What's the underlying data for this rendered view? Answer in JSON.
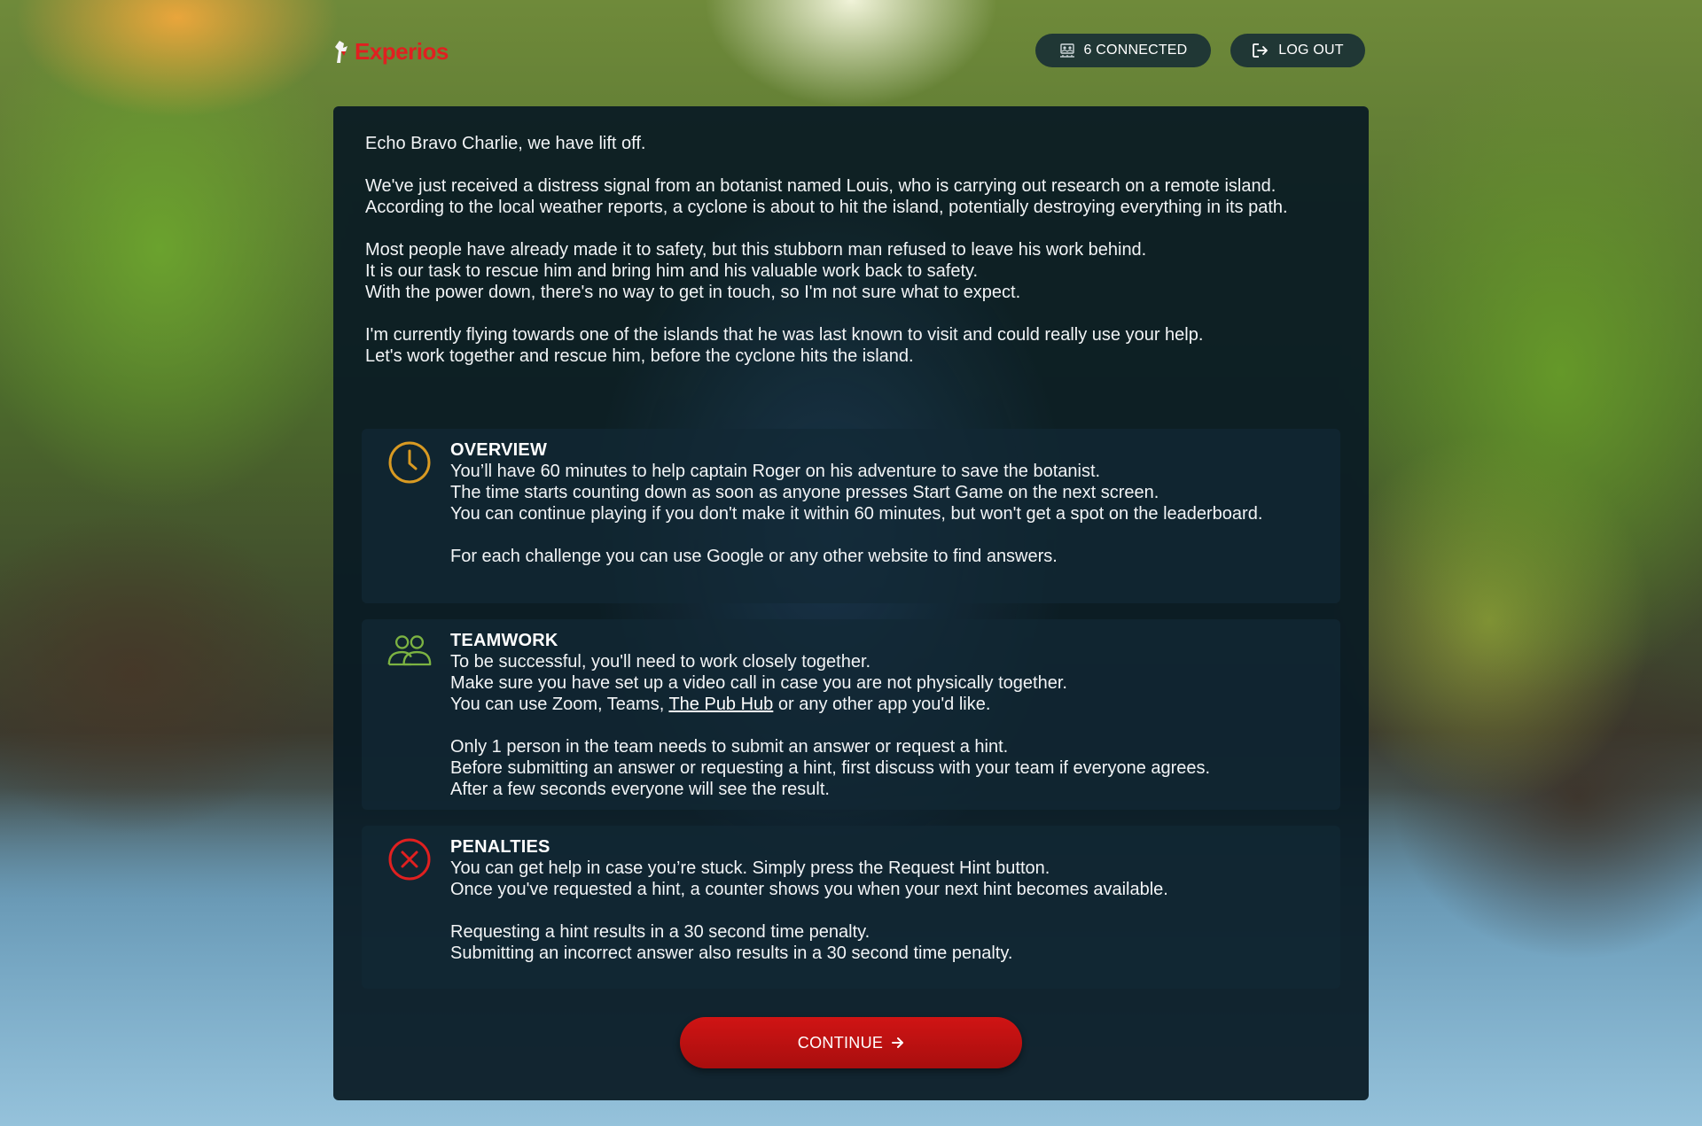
{
  "brand": {
    "name": "Experios",
    "logo_color": "#e02020"
  },
  "header": {
    "connected_label": "6 CONNECTED",
    "connected_icon": "users-icon",
    "logout_label": "LOG OUT",
    "logout_icon": "logout-icon"
  },
  "intro": {
    "greeting": "Echo Bravo Charlie, we have lift off.",
    "paragraph1": "We've just received a distress signal from an botanist named Louis, who is carrying out research on a remote island. According to the local weather reports, a cyclone is about to hit the island, potentially destroying everything in its path.",
    "paragraph2": [
      "Most people have already made it to safety, but this stubborn man refused to leave his work behind.",
      "It is our task to rescue him and bring him and his valuable work back to safety.",
      "With the power down, there's no way to get in touch, so I'm not sure what to expect."
    ],
    "paragraph3": [
      "I'm currently flying towards one of the islands that he was last known to visit and could really use your help.",
      "Let's work together and rescue him, before the cyclone hits the island."
    ]
  },
  "sections": {
    "overview": {
      "title": "OVERVIEW",
      "icon": "clock-icon",
      "icon_color": "#d99a22",
      "lines": [
        "You’ll have 60 minutes to help captain Roger on his adventure to save the botanist.",
        "The time starts counting down as soon as anyone presses Start Game on the next screen.",
        "You can continue playing if you don't make it within 60 minutes, but won't get a spot on the leaderboard."
      ],
      "note": "For each challenge you can use Google or any other website to find answers."
    },
    "teamwork": {
      "title": "TEAMWORK",
      "icon": "team-icon",
      "icon_color": "#7cb342",
      "lines": [
        "To be successful, you'll need to work closely together.",
        "Make sure you have set up a video call in case you are not physically together."
      ],
      "apps_prefix": "You can use Zoom, Teams, ",
      "apps_link": "The Pub Hub",
      "apps_suffix": " or any other app you'd like.",
      "lines2": [
        "Only 1 person in the team needs to submit an answer or request a hint.",
        "Before submitting an answer or requesting a hint, first discuss with your team if everyone agrees.",
        "After a few seconds everyone will see the result."
      ]
    },
    "penalties": {
      "title": "PENALTIES",
      "icon": "close-circle-icon",
      "icon_color": "#e02020",
      "lines": [
        "You can get help in case you’re stuck. Simply press the Request Hint button.",
        "Once you've requested a hint, a counter shows you when your next hint becomes available."
      ],
      "lines2": [
        "Requesting a hint results in a 30 second time penalty.",
        "Submitting an incorrect answer also results in a 30 second time penalty."
      ]
    }
  },
  "continue_button": {
    "label": "CONTINUE",
    "icon": "arrow-right-icon",
    "color": "#c41212"
  }
}
